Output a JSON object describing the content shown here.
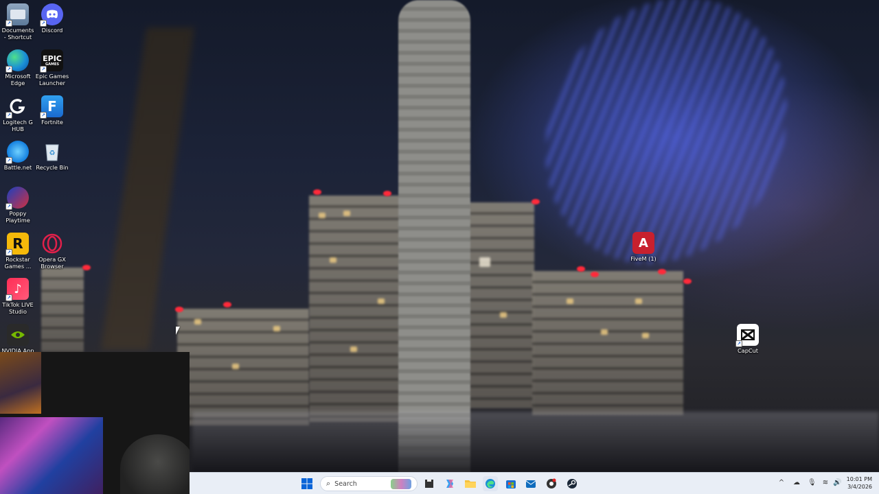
{
  "desktop": {
    "icons": [
      {
        "label": "Documents - Shortcut",
        "icon": "folder-icon"
      },
      {
        "label": "Discord",
        "icon": "discord-icon"
      },
      {
        "label": "Microsoft Edge",
        "icon": "edge-icon"
      },
      {
        "label": "Epic Games Launcher",
        "icon": "epic-games-icon"
      },
      {
        "label": "Logitech G HUB",
        "icon": "logitech-icon"
      },
      {
        "label": "Fortnite",
        "icon": "fortnite-icon"
      },
      {
        "label": "Battle.net",
        "icon": "battlenet-icon"
      },
      {
        "label": "Recycle Bin",
        "icon": "recycle-bin-icon"
      },
      {
        "label": "Poppy Playtime",
        "icon": "poppy-playtime-icon"
      },
      {
        "label": "Rockstar Games ...",
        "icon": "rockstar-icon"
      },
      {
        "label": "Opera GX Browser",
        "icon": "opera-gx-icon"
      },
      {
        "label": "TikTok LIVE Studio",
        "icon": "tiktok-icon"
      },
      {
        "label": "NVIDIA App",
        "icon": "nvidia-icon"
      },
      {
        "label": "FiveM (1)",
        "icon": "fivem-icon"
      },
      {
        "label": "CapCut",
        "icon": "capcut-icon"
      }
    ],
    "epic_logo_text": "EPIC",
    "epic_logo_sub": "GAMES",
    "fortnite_glyph": "F",
    "rockstar_glyph": "R",
    "fivem_glyph": "A"
  },
  "taskbar": {
    "search_placeholder": "Search",
    "apps": [
      "start-icon",
      "search-icon",
      "file-manager-icon",
      "copilot-icon",
      "file-explorer-icon",
      "edge-icon",
      "microsoft-store-icon",
      "outlook-icon",
      "chrome-icon",
      "steam-icon"
    ],
    "tray": [
      "chevron-up-icon",
      "cloud-icon",
      "microphone-icon",
      "wifi-icon",
      "speaker-icon"
    ],
    "time": "10:01 PM",
    "date": "3/4/2026"
  },
  "colors": {
    "taskbar_bg": "#e9eef6",
    "accent_blue": "#0a64d8"
  }
}
